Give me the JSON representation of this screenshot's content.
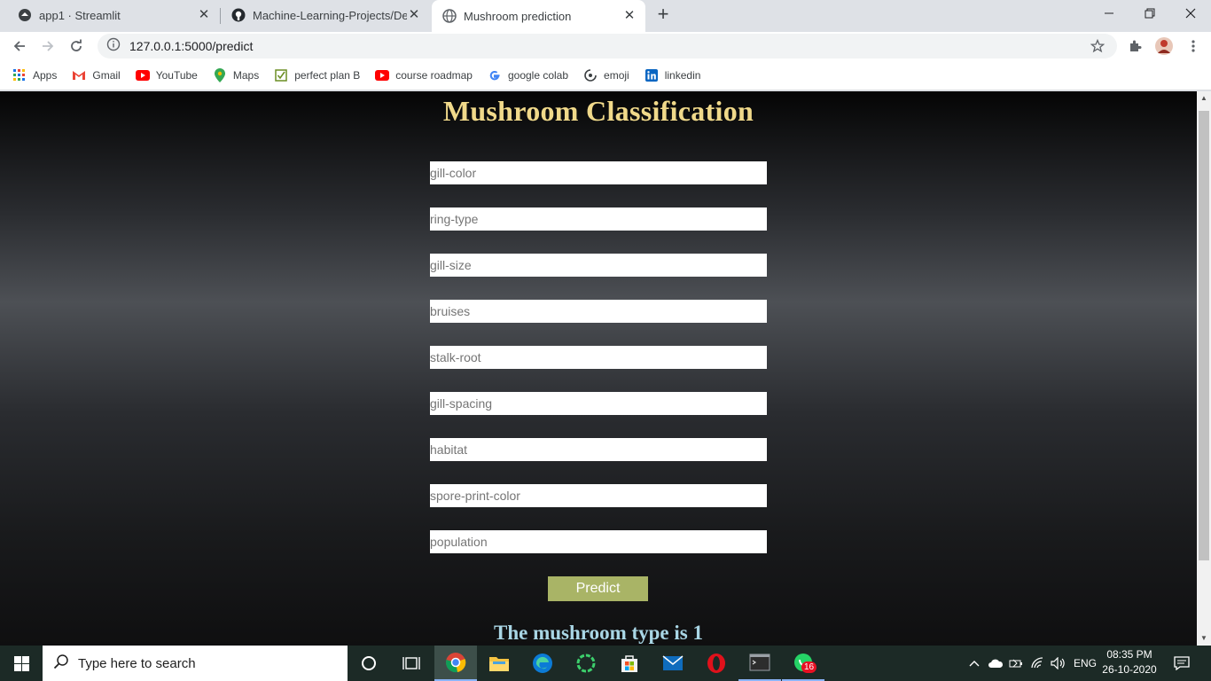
{
  "tabs": [
    {
      "title": "app1 · Streamlit",
      "icon": "streamlit-icon"
    },
    {
      "title": "Machine-Learning-Projects/Decis",
      "icon": "github-icon"
    },
    {
      "title": "Mushroom prediction",
      "icon": "globe-icon"
    }
  ],
  "address_bar": {
    "url": "127.0.0.1:5000/predict"
  },
  "bookmarks": [
    {
      "label": "Apps",
      "icon": "apps-grid-icon"
    },
    {
      "label": "Gmail",
      "icon": "gmail-icon"
    },
    {
      "label": "YouTube",
      "icon": "youtube-icon"
    },
    {
      "label": "Maps",
      "icon": "maps-icon"
    },
    {
      "label": "perfect plan B",
      "icon": "checkbox-icon"
    },
    {
      "label": "course roadmap",
      "icon": "youtube-icon"
    },
    {
      "label": "google colab",
      "icon": "google-icon"
    },
    {
      "label": "emoji",
      "icon": "emoji-icon"
    },
    {
      "label": "linkedin",
      "icon": "linkedin-icon"
    }
  ],
  "page": {
    "title": "Mushroom Classification",
    "fields": [
      {
        "placeholder": "gill-color"
      },
      {
        "placeholder": "ring-type"
      },
      {
        "placeholder": "gill-size"
      },
      {
        "placeholder": "bruises"
      },
      {
        "placeholder": "stalk-root"
      },
      {
        "placeholder": "gill-spacing"
      },
      {
        "placeholder": "habitat"
      },
      {
        "placeholder": "spore-print-color"
      },
      {
        "placeholder": "population"
      }
    ],
    "predict_label": "Predict",
    "result_text": "The mushroom type is 1"
  },
  "taskbar": {
    "search_placeholder": "Type here to search",
    "language": "ENG",
    "time": "08:35 PM",
    "date": "26-10-2020",
    "whatsapp_badge": "16"
  },
  "colors": {
    "title": "#f0d98a",
    "button": "#a9b466",
    "result": "#a9d6e5"
  }
}
